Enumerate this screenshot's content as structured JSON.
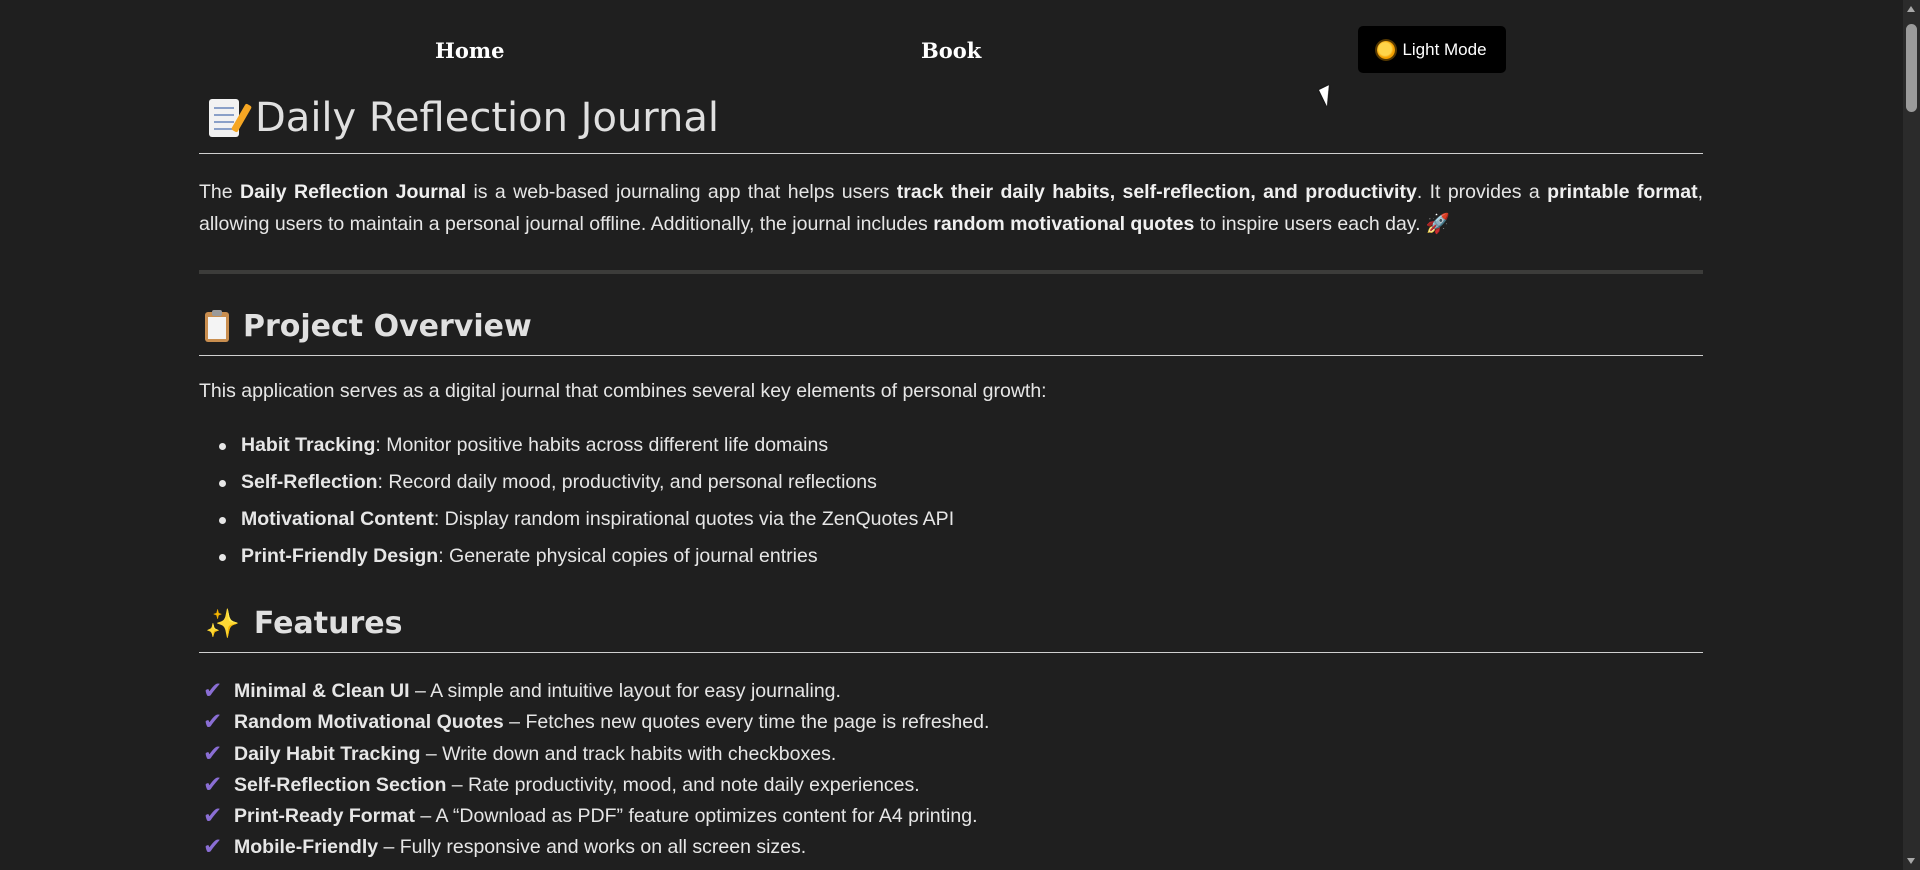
{
  "nav": {
    "home_label": "Home",
    "book_label": "Book",
    "theme_button_label": "Light Mode",
    "theme_button_icon": "sun-icon"
  },
  "title": {
    "icon": "memo-icon",
    "text": "Daily Reflection Journal"
  },
  "intro": {
    "t1": "The ",
    "b1": "Daily Reflection Journal",
    "t2": " is a web-based journaling app that helps users ",
    "b2": "track their daily habits, self-reflection, and productivity",
    "t3": ". It provides a ",
    "b3": "printable format",
    "t4": ", allowing users to maintain a personal journal offline. Additionally, the journal includes ",
    "b4": "random motivational quotes",
    "t5": " to inspire users each day. 🚀"
  },
  "overview": {
    "icon": "clipboard-icon",
    "heading": "Project Overview",
    "intro": "This application serves as a digital journal that combines several key elements of personal growth:",
    "items": [
      {
        "label": "Habit Tracking",
        "text": ": Monitor positive habits across different life domains"
      },
      {
        "label": "Self-Reflection",
        "text": ": Record daily mood, productivity, and personal reflections"
      },
      {
        "label": "Motivational Content",
        "text": ": Display random inspirational quotes via the ZenQuotes API"
      },
      {
        "label": "Print-Friendly Design",
        "text": ": Generate physical copies of journal entries"
      }
    ]
  },
  "features": {
    "icon": "sparkles-icon",
    "heading": "Features",
    "items": [
      {
        "label": "Minimal & Clean UI",
        "text": " – A simple and intuitive layout for easy journaling."
      },
      {
        "label": "Random Motivational Quotes",
        "text": " – Fetches new quotes every time the page is refreshed."
      },
      {
        "label": "Daily Habit Tracking",
        "text": " – Write down and track habits with checkboxes."
      },
      {
        "label": "Self-Reflection Section",
        "text": " – Rate productivity, mood, and note daily experiences."
      },
      {
        "label": "Print-Ready Format",
        "text": " – A “Download as PDF” feature optimizes content for A4 printing."
      },
      {
        "label": "Mobile-Friendly",
        "text": " – Fully responsive and works on all screen sizes."
      }
    ]
  },
  "colors": {
    "background": "#1f1f1f",
    "text": "#e6e6e6",
    "check": "#8a6ed4",
    "theme_button": "#000000"
  }
}
